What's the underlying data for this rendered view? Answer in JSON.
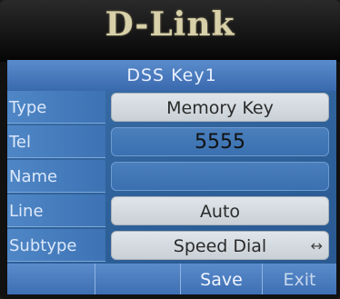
{
  "device": {
    "brand": "D-Link"
  },
  "screen": {
    "title": "DSS Key1",
    "rows": [
      {
        "label": "Type",
        "value": "Memory Key"
      },
      {
        "label": "Tel",
        "value": "5555"
      },
      {
        "label": "Name",
        "value": ""
      },
      {
        "label": "Line",
        "value": "Auto"
      },
      {
        "label": "Subtype",
        "value": "Speed Dial"
      }
    ],
    "softkeys": [
      "",
      "",
      "Save",
      "Exit"
    ],
    "subtype_arrows": "↔"
  }
}
